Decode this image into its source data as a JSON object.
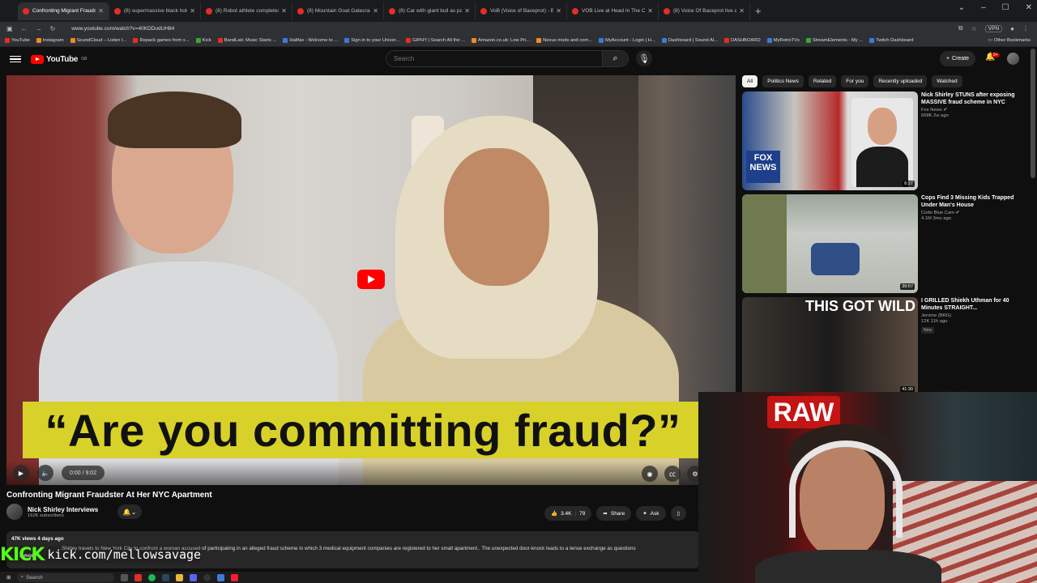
{
  "browser": {
    "tabs": [
      {
        "label": "Confronting Migrant Fraudst",
        "active": true
      },
      {
        "label": "(8) supermassive black hole (m",
        "active": false
      },
      {
        "label": "(8) Robot athlete completes 40",
        "active": false
      },
      {
        "label": "(8) Mountain Goat Gatecrashes",
        "active": false
      },
      {
        "label": "(8) Car with giant bull as passe",
        "active": false
      },
      {
        "label": "VoB (Voice of Baceprot) - Be",
        "active": false
      },
      {
        "label": "VOB Live at Head In The Cloud",
        "active": false
      },
      {
        "label": "(8) Voice Of Baceprot live at Co",
        "active": false
      }
    ],
    "new_tab": "+",
    "url": "www.youtube.com/watch?v=40KDDodUH84",
    "vpn_label": "VPN",
    "bookmarks": [
      "YouTube",
      "Instagram",
      "SoundCloud – Listen t...",
      "Repack games from x...",
      "Kick",
      "BandLab: Music Starts ...",
      "Halifax - Welcome to ...",
      "Sign in to your Univer...",
      "GIPHY | Search All the ...",
      "Amazon.co.uk: Low Pri...",
      "Nexus mods and com...",
      "MyAccount - Login | H...",
      "Dashboard | Sound Al...",
      "DASHBOARD",
      "MyRetroTVs",
      "StreamElements - My ...",
      "Twitch Dashboard"
    ],
    "other_bookmarks": "Other Bookmarks"
  },
  "youtube": {
    "logo_text": "YouTube",
    "logo_region": "GB",
    "search_placeholder": "Search",
    "create_label": "Create",
    "notification_count": "9+"
  },
  "video": {
    "caption": "“Are you committing fraud?”",
    "time": "0:00 / 9:02",
    "title": "Confronting Migrant Fraudster At Her NYC Apartment",
    "channel": "Nick Shirley Interviews",
    "subscribers": "162K subscribers",
    "likes": "3.4K",
    "comments": "79",
    "share_label": "Share",
    "ask_label": "Ask",
    "meta": "47K views  4 days ago",
    "description": "Shirley travels to New York City to confront a woman accused of participating in an alleged fraud scheme in which 3 medical equipment companies are registered to her small apartment.. The unexpected door-knock leads to a tense exchange as questions",
    "more": "...more"
  },
  "chips": [
    {
      "label": "All",
      "active": true
    },
    {
      "label": "Politics News",
      "active": false
    },
    {
      "label": "Related",
      "active": false
    },
    {
      "label": "For you",
      "active": false
    },
    {
      "label": "Recently uploaded",
      "active": false
    },
    {
      "label": "Watched",
      "active": false
    }
  ],
  "recommendations": [
    {
      "title": "Nick Shirley STUNS after exposing MASSIVE fraud scheme in NYC",
      "channel": "Fox News",
      "stats": "668K  2w ago",
      "duration": "6:27",
      "thumb_text": "FOX NEWS",
      "new": false
    },
    {
      "title": "Cops Find 3 Missing Kids Trapped Under Man's House",
      "channel": "Code Blue Cam",
      "stats": "4.1M  3mo ago",
      "duration": "39:57",
      "thumb_text": "",
      "new": false
    },
    {
      "title": "I GRILLED Shiekh Uthman for 40 Minutes STRAIGHT...",
      "channel": "Jerome (BRG)",
      "stats": "12K  11h ago",
      "duration": "41:30",
      "thumb_text": "THIS GOT WILD",
      "new": true,
      "new_label": "New"
    }
  ],
  "overlay": {
    "kick_logo": "KICK",
    "kick_url": "kick.com/mellowsavage",
    "webcam_sign": "RAW"
  },
  "taskbar": {
    "search": "Search"
  }
}
